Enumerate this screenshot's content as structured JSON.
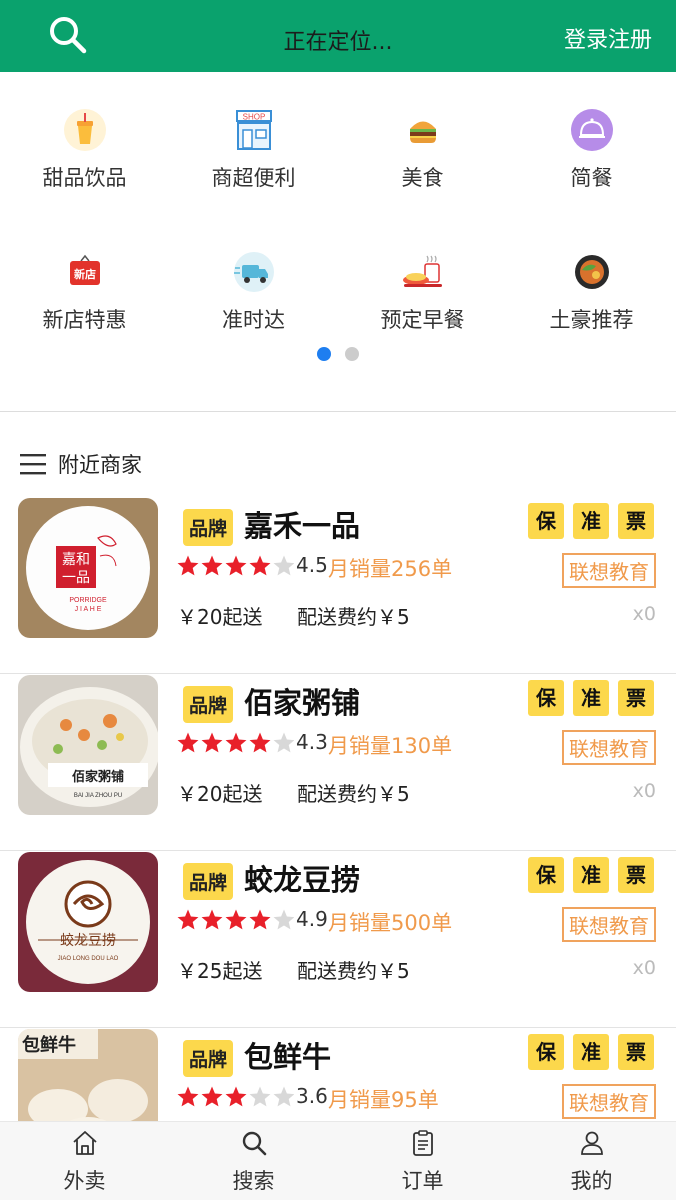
{
  "header": {
    "search_icon": "search-icon",
    "location": "正在定位...",
    "login": "登录注册",
    "bg_color": "#0aa26d"
  },
  "categories": {
    "row1": [
      {
        "label": "甜品饮品",
        "icon": "drink-icon"
      },
      {
        "label": "商超便利",
        "icon": "shop-icon"
      },
      {
        "label": "美食",
        "icon": "burger-icon"
      },
      {
        "label": "简餐",
        "icon": "cloche-icon"
      }
    ],
    "row2": [
      {
        "label": "新店特惠",
        "icon": "new-store-icon"
      },
      {
        "label": "准时达",
        "icon": "delivery-truck-icon"
      },
      {
        "label": "预定早餐",
        "icon": "breakfast-icon"
      },
      {
        "label": "土豪推荐",
        "icon": "dish-icon"
      }
    ],
    "page_indicator": {
      "count": 2,
      "active": 0
    }
  },
  "section": {
    "title": "附近商家",
    "icon": "list-icon"
  },
  "shops": [
    {
      "brand": "品牌",
      "name": "嘉禾一品",
      "stars": 4,
      "rating": "4.5",
      "sales": "月销量256单",
      "min_price": "￥20起送",
      "delivery_fee": "配送费约￥5",
      "tags": [
        "保",
        "准",
        "票"
      ],
      "promo": "联想教育",
      "count": "x0",
      "logo_text": "嘉和\n一品",
      "logo_sub": "PORRIDGE JIAHE"
    },
    {
      "brand": "品牌",
      "name": "佰家粥铺",
      "stars": 4,
      "rating": "4.3",
      "sales": "月销量130单",
      "min_price": "￥20起送",
      "delivery_fee": "配送费约￥5",
      "tags": [
        "保",
        "准",
        "票"
      ],
      "promo": "联想教育",
      "count": "x0",
      "logo_text": "佰家粥铺",
      "logo_sub": "BAI JIA ZHOU PU"
    },
    {
      "brand": "品牌",
      "name": "蛟龙豆捞",
      "stars": 4,
      "rating": "4.9",
      "sales": "月销量500单",
      "min_price": "￥25起送",
      "delivery_fee": "配送费约￥5",
      "tags": [
        "保",
        "准",
        "票"
      ],
      "promo": "联想教育",
      "count": "x0",
      "logo_text": "蛟龙豆捞",
      "logo_sub": "JIAO LONG DOU LAO"
    },
    {
      "brand": "品牌",
      "name": "包鲜牛",
      "stars": 3,
      "rating": "3.6",
      "sales": "月销量95单",
      "min_price": "",
      "delivery_fee": "",
      "tags": [
        "保",
        "准",
        "票"
      ],
      "promo": "联想教育",
      "count": "",
      "logo_text": "包鲜牛",
      "logo_sub": ""
    }
  ],
  "nav": [
    {
      "label": "外卖",
      "icon": "home-icon"
    },
    {
      "label": "搜索",
      "icon": "search-icon"
    },
    {
      "label": "订单",
      "icon": "clipboard-icon"
    },
    {
      "label": "我的",
      "icon": "user-icon"
    }
  ],
  "colors": {
    "star": "#e8202a",
    "star_empty": "#d8d8d8",
    "brand_tag": "#fcd84c",
    "sales": "#f09a4b",
    "dot_active": "#1e7ef0"
  }
}
